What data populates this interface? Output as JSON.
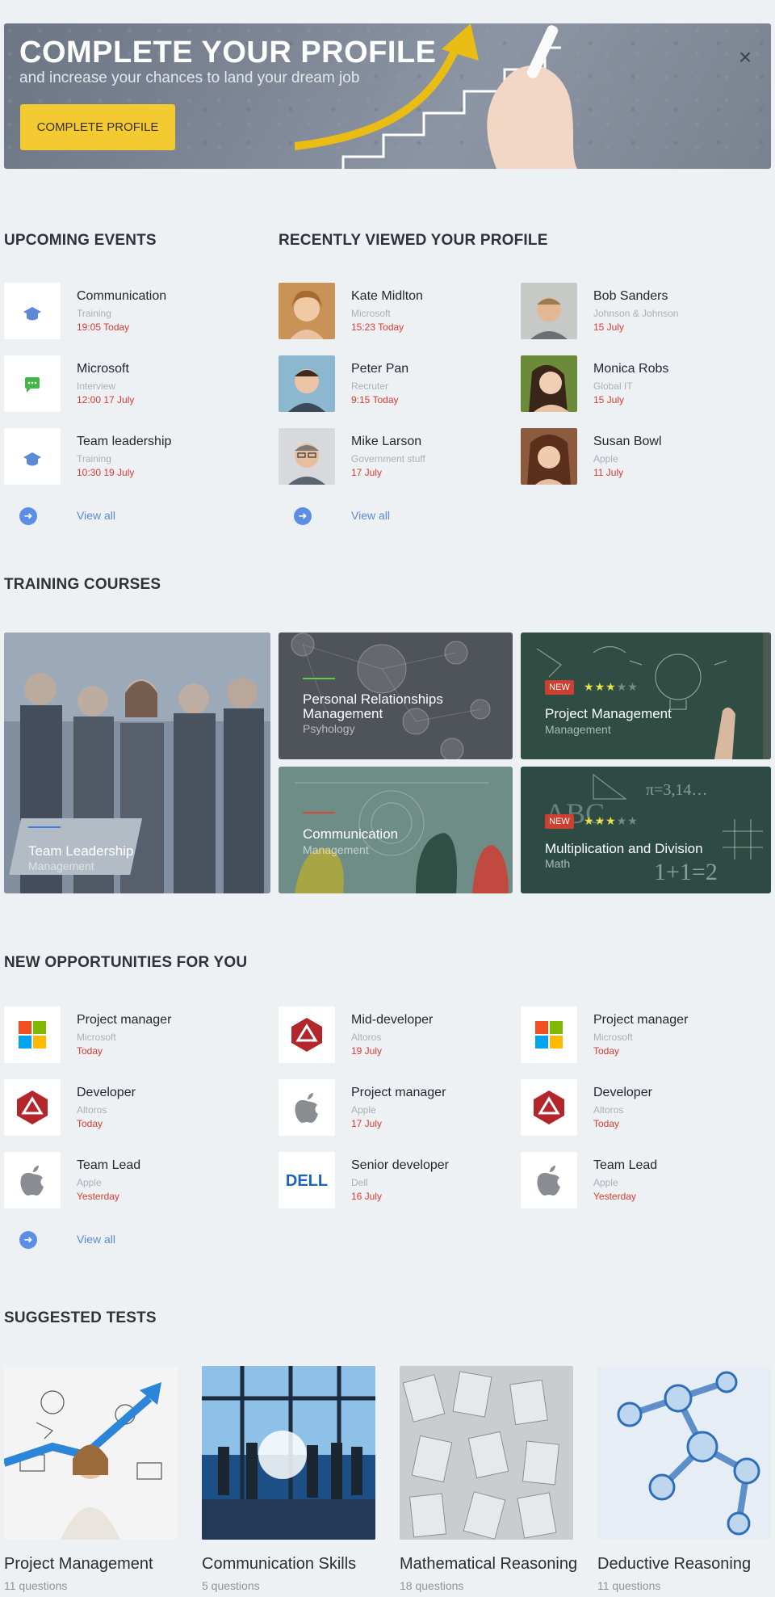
{
  "banner": {
    "title": "COMPLETE YOUR PROFILE",
    "subtitle": "and increase your chances to land your dream job",
    "button_label": "COMPLETE PROFILE",
    "close_symbol": "×"
  },
  "events": {
    "title": "UPCOMING EVENTS",
    "items": [
      {
        "name": "Communication",
        "type": "Training",
        "time": "19:05  Today",
        "icon": "graduation-cap-icon"
      },
      {
        "name": "Microsoft",
        "type": "Interview",
        "time": "12:00  17 July",
        "icon": "chat-icon"
      },
      {
        "name": "Team leadership",
        "type": "Training",
        "time": "10:30  19 July",
        "icon": "graduation-cap-icon"
      }
    ],
    "view_all": "View all"
  },
  "viewers": {
    "title": "RECENTLY VIEWED YOUR PROFILE",
    "items": [
      {
        "name": "Kate Midlton",
        "company": "Microsoft",
        "time": "15:23  Today"
      },
      {
        "name": "Peter Pan",
        "company": "Recruter",
        "time": "9:15  Today"
      },
      {
        "name": "Mike Larson",
        "company": "Government stuff",
        "time": "17 July"
      },
      {
        "name": "Bob Sanders",
        "company": "Johnson & Johnson",
        "time": "15 July"
      },
      {
        "name": "Monica Robs",
        "company": "Global IT",
        "time": "15 July"
      },
      {
        "name": "Susan Bowl",
        "company": "Apple",
        "time": "11 July"
      }
    ],
    "view_all": "View all"
  },
  "courses": {
    "title": "TRAINING COURSES",
    "items": [
      {
        "title": "Team Leadership",
        "category": "Management"
      },
      {
        "title": "Personal Relationships Management",
        "category": "Psyhology"
      },
      {
        "title": "Project Management",
        "category": "Management",
        "badge": "NEW",
        "rating": 3
      },
      {
        "title": "Communication",
        "category": "Management"
      },
      {
        "title": "Multiplication and Division",
        "category": "Math",
        "badge": "NEW",
        "rating": 3
      }
    ],
    "star": "★",
    "accent_colors": {
      "team": "#3f7fdd",
      "personal": "#5ccf4b",
      "communication": "#d9473b"
    }
  },
  "opportunities": {
    "title": "NEW OPPORTUNITIES FOR YOU",
    "items": [
      {
        "role": "Project manager",
        "company": "Microsoft",
        "date": "Today",
        "logo": "microsoft-logo"
      },
      {
        "role": "Developer",
        "company": "Altoros",
        "date": "Today",
        "logo": "altoros-logo"
      },
      {
        "role": "Team Lead",
        "company": "Apple",
        "date": "Yesterday",
        "logo": "apple-logo"
      },
      {
        "role": "Mid-developer",
        "company": "Altoros",
        "date": "19 July",
        "logo": "altoros-logo"
      },
      {
        "role": "Project manager",
        "company": "Apple",
        "date": "17 July",
        "logo": "apple-logo"
      },
      {
        "role": "Senior developer",
        "company": "Dell",
        "date": "16 July",
        "logo": "dell-logo"
      },
      {
        "role": "Project manager",
        "company": "Microsoft",
        "date": "Today",
        "logo": "microsoft-logo"
      },
      {
        "role": "Developer",
        "company": "Altoros",
        "date": "Today",
        "logo": "altoros-logo"
      },
      {
        "role": "Team Lead",
        "company": "Apple",
        "date": "Yesterday",
        "logo": "apple-logo"
      }
    ],
    "dell_text": "DELL",
    "view_all": "View all"
  },
  "tests": {
    "title": "SUGGESTED TESTS",
    "items": [
      {
        "name": "Project Management",
        "questions": "11 questions"
      },
      {
        "name": "Communication Skills",
        "questions": "5 questions"
      },
      {
        "name": "Mathematical Reasoning",
        "questions": "18 questions"
      },
      {
        "name": "Deductive Reasoning",
        "questions": "11 questions"
      }
    ],
    "math_formula": "1+1=2",
    "math_pi": "π=3,14…",
    "math_abc": "ABC"
  },
  "colors": {
    "accent_red": "#d93b33",
    "link_blue": "#5b8ad7",
    "button_yellow": "#f3ca31",
    "background": "#edf1f4"
  }
}
